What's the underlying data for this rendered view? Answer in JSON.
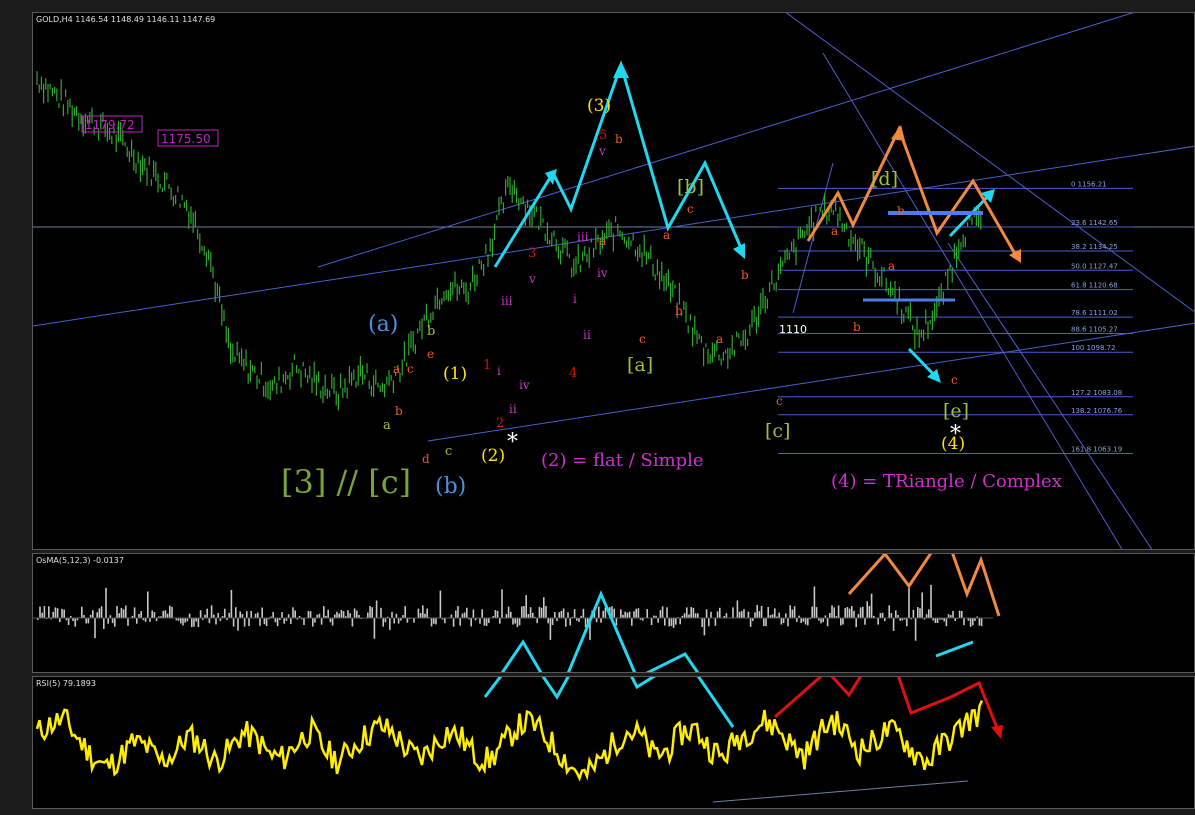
{
  "main": {
    "title": "GOLD,H4  1146.54 1148.49 1146.11 1147.69",
    "price_boxes": [
      "1179.72",
      "1175.50"
    ],
    "level_label": "1110",
    "fib_levels": [
      "0 1156.21",
      "23.6 1142.65",
      "38.2 1134.25",
      "50.0 1127.47",
      "61.8 1120.68",
      "78.6 1111.02",
      "88.6 1105.27",
      "100 1098.72",
      "127.2 1083.08",
      "138.2 1076.76",
      "161.8 1063.19"
    ],
    "annotations": {
      "flat": "(2) = flat / Simple",
      "triangle": "(4) = TRiangle / Complex",
      "big_label": "[3] // [c]"
    },
    "wave_labels": [
      "(a)",
      "(b)",
      "(1)",
      "(2)",
      "(3)",
      "(4)",
      "[a]",
      "[b]",
      "[c]",
      "[d]",
      "[e]",
      "a",
      "b",
      "c",
      "d",
      "e",
      "i",
      "ii",
      "iii",
      "iv",
      "v",
      "1",
      "2",
      "3",
      "4",
      "5",
      "*"
    ]
  },
  "osma": {
    "title": "OsMA(5,12,3) -0.0137"
  },
  "rsi": {
    "title": "RSI(5) 79.1893"
  },
  "colors": {
    "price": "#2ea82e",
    "osma": "#c8c8c8",
    "rsi": "#ffee00",
    "cyan": "#22d8f0",
    "orange": "#f08a40",
    "red": "#e01010",
    "blue_line": "#4b5fd0",
    "magenta": "#d030d0"
  },
  "chart_data": [
    {
      "type": "line",
      "title": "GOLD,H4",
      "y_prices": [
        1179.72,
        1175.5,
        1156.21,
        1142.65,
        1134.25,
        1127.47,
        1120.68,
        1111.02,
        1110,
        1105.27,
        1098.72,
        1083.08,
        1076.76,
        1063.19
      ],
      "series": [
        {
          "values": [
            1195,
            1188,
            1182,
            1178,
            1172,
            1164,
            1158,
            1150,
            1133,
            1098,
            1092,
            1086,
            1094,
            1088,
            1084,
            1092,
            1086,
            1094,
            1110,
            1122,
            1120,
            1135,
            1158,
            1148,
            1140,
            1128,
            1136,
            1142,
            1136,
            1126,
            1114,
            1100,
            1098,
            1104,
            1120,
            1132,
            1144,
            1150,
            1138,
            1128,
            1118,
            1104,
            1116,
            1140,
            1147
          ]
        }
      ]
    },
    {
      "type": "bar",
      "title": "OsMA(5,12,3) -0.0137",
      "values": [
        0.4,
        -0.3,
        0.6,
        0.2,
        -0.5,
        0.3,
        0.7,
        -0.2,
        0.5,
        -1.2,
        0.3,
        0.4,
        -0.4,
        0.6,
        1.0,
        -0.3,
        0.5,
        0.8,
        -0.6,
        0.3,
        0.9,
        -0.4,
        0.6,
        0.5,
        -0.3,
        0.7,
        -0.5,
        0.4,
        0.6,
        -0.4,
        0.5,
        0.8,
        -0.7,
        0.4,
        0.6,
        -0.4,
        1.1,
        0.5,
        -0.6,
        0.6,
        -0.4,
        -0.0137
      ]
    },
    {
      "type": "line",
      "title": "RSI(5) 79.1893",
      "values": [
        60,
        68,
        72,
        55,
        40,
        30,
        38,
        52,
        48,
        35,
        42,
        58,
        50,
        35,
        45,
        60,
        55,
        40,
        38,
        52,
        62,
        45,
        35,
        48,
        58,
        66,
        60,
        45,
        38,
        50,
        62,
        55,
        40,
        36,
        50,
        65,
        70,
        58,
        45,
        30,
        22,
        35,
        50,
        62,
        58,
        40,
        45,
        60,
        64,
        48,
        38,
        55,
        62,
        70,
        65,
        50,
        40,
        58,
        72,
        60,
        45,
        52,
        62,
        58,
        42,
        35,
        50,
        60,
        72,
        79.19
      ]
    }
  ]
}
